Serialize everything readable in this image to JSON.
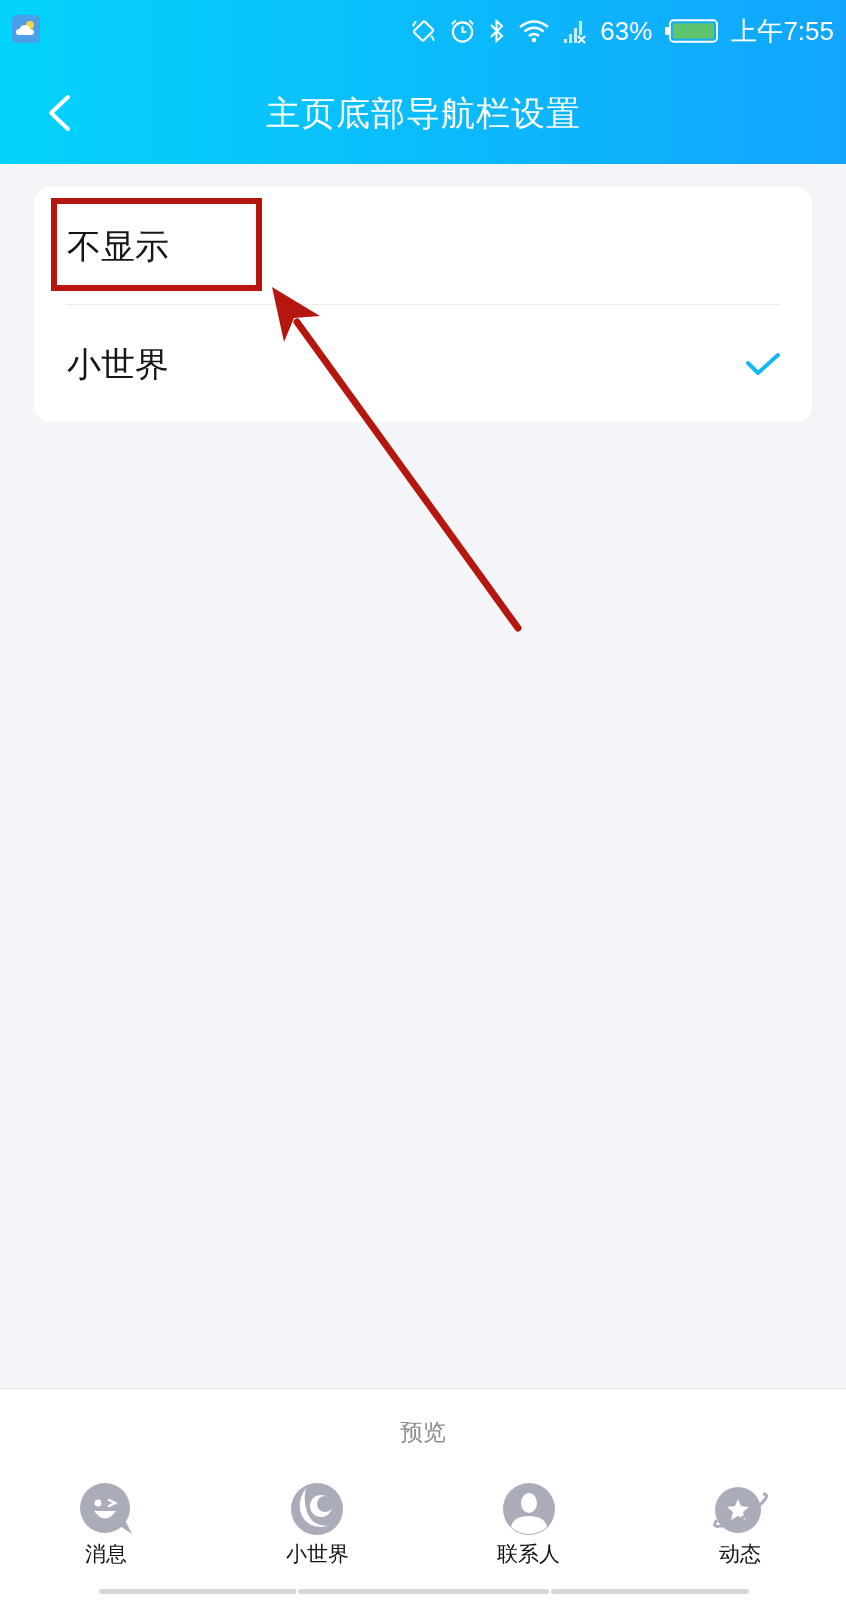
{
  "status_bar": {
    "battery_percent": "63%",
    "time": "上午7:55"
  },
  "header": {
    "title": "主页底部导航栏设置"
  },
  "options": [
    {
      "label": "不显示",
      "selected": false,
      "highlighted": true
    },
    {
      "label": "小世界",
      "selected": true,
      "highlighted": false
    }
  ],
  "preview": {
    "title": "预览",
    "tabs": [
      {
        "label": "消息",
        "kind": "chat"
      },
      {
        "label": "小世界",
        "kind": "crescent"
      },
      {
        "label": "联系人",
        "kind": "person"
      },
      {
        "label": "动态",
        "kind": "planet"
      }
    ]
  }
}
